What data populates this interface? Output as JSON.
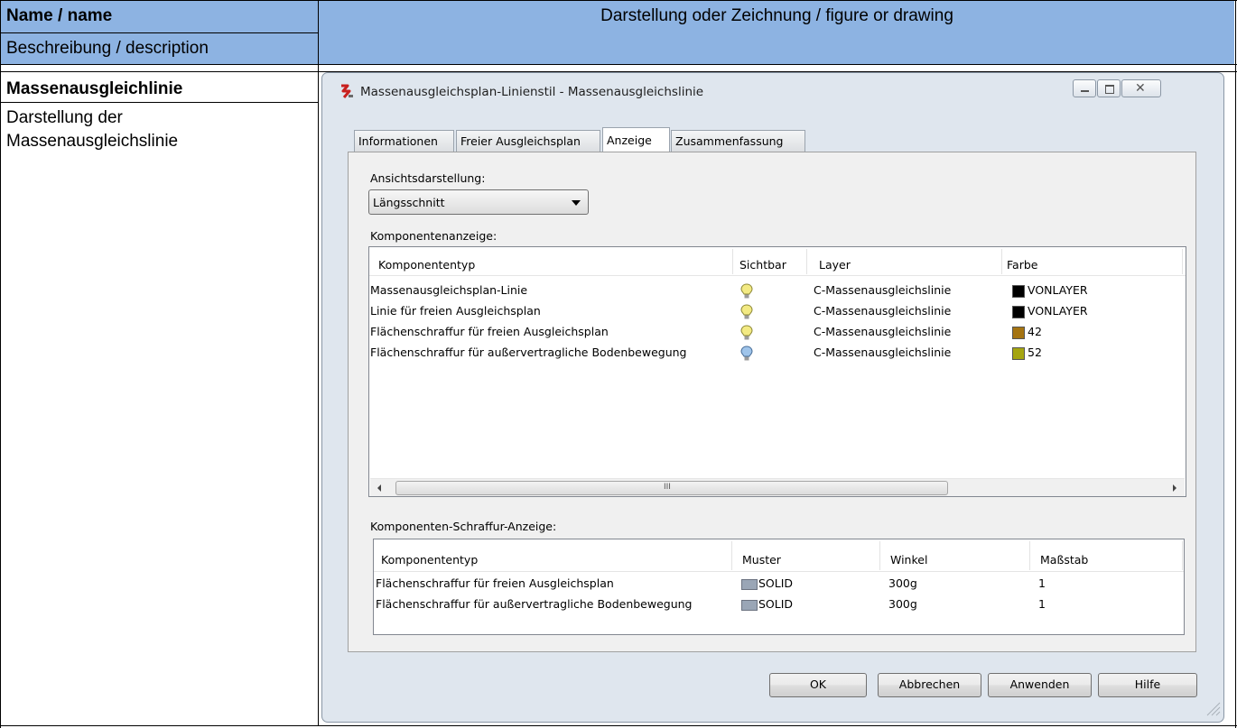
{
  "table": {
    "header_left_top": "Name / name",
    "header_left_bottom": "Beschreibung / description",
    "header_right": "Darstellung oder Zeichnung / figure or drawing",
    "item_name": "Massenausgleichlinie",
    "item_description": "Darstellung der Massenausgleichslinie"
  },
  "dialog": {
    "title": "Massenausgleichsplan-Linienstil - Massenausgleichslinie",
    "tabs": [
      {
        "label": "Informationen",
        "active": false
      },
      {
        "label": "Freier Ausgleichsplan",
        "active": false
      },
      {
        "label": "Anzeige",
        "active": true
      },
      {
        "label": "Zusammenfassung",
        "active": false
      }
    ],
    "view_label": "Ansichtsdarstellung:",
    "view_value": "Längsschnitt",
    "components_label": "Komponentenanzeige:",
    "components": {
      "headers": [
        "Komponententyp",
        "Sichtbar",
        "Layer",
        "Farbe"
      ],
      "rows": [
        {
          "type": "Massenausgleichsplan-Linie",
          "visible_icon": "lightbulb-on",
          "layer": "C-Massenausgleichslinie",
          "color_name": "VONLAYER",
          "color_hex": "#000000"
        },
        {
          "type": "Linie für freien Ausgleichsplan",
          "visible_icon": "lightbulb-on",
          "layer": "C-Massenausgleichslinie",
          "color_name": "VONLAYER",
          "color_hex": "#000000"
        },
        {
          "type": "Flächenschraffur für freien Ausgleichsplan",
          "visible_icon": "lightbulb-on",
          "layer": "C-Massenausgleichslinie",
          "color_name": "42",
          "color_hex": "#a57411"
        },
        {
          "type": "Flächenschraffur für außervertragliche Bodenbewegung",
          "visible_icon": "lightbulb-off",
          "layer": "C-Massenausgleichslinie",
          "color_name": "52",
          "color_hex": "#a5a511"
        }
      ]
    },
    "hatch_label": "Komponenten-Schraffur-Anzeige:",
    "hatch": {
      "headers": [
        "Komponententyp",
        "Muster",
        "Winkel",
        "Maßstab"
      ],
      "rows": [
        {
          "type": "Flächenschraffur für freien Ausgleichsplan",
          "pattern": "SOLID",
          "angle": "300g",
          "scale": "1"
        },
        {
          "type": "Flächenschraffur für außervertragliche Bodenbewegung",
          "pattern": "SOLID",
          "angle": "300g",
          "scale": "1"
        }
      ]
    },
    "buttons": {
      "ok": "OK",
      "cancel": "Abbrechen",
      "apply": "Anwenden",
      "help": "Hilfe"
    },
    "scrollbar_grip": "III"
  },
  "colors": {
    "header_bg": "#8db3e2",
    "bulb_on": "#f3ea83",
    "bulb_off": "#9fc4ea"
  }
}
